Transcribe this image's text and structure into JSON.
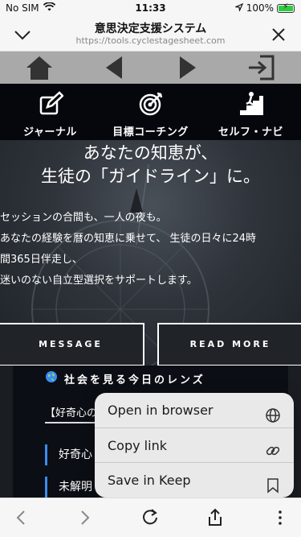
{
  "status_bar": {
    "carrier": "No SIM",
    "time": "11:33",
    "battery": "100%",
    "battery_level": 1.0
  },
  "browser": {
    "title": "意思決定支援システム",
    "url": "https://tools.cyclestagesheet.com"
  },
  "site_nav": {
    "icons": [
      "home-icon",
      "back-arrow-icon",
      "forward-arrow-icon",
      "logout-icon"
    ]
  },
  "category_menu": {
    "items": [
      {
        "label": "ジャーナル",
        "icon": "edit-icon"
      },
      {
        "label": "目標コーチング",
        "icon": "target-icon"
      },
      {
        "label": "セルフ・ナビ",
        "icon": "climb-stairs-icon"
      }
    ]
  },
  "hero": {
    "title_line1": "あなたの知恵が、",
    "title_line2": "生徒の「ガイドライン」に。",
    "body_line1": "セッションの合間も、一人の夜も。",
    "body_line2": "あなたの経験を暦の知恵に乗せて、 生徒の日々に24時",
    "body_line3": "間365日伴走し、",
    "body_line4": "迷いのない自立型選択をサポートします。",
    "btn_message": "MESSAGE",
    "btn_readmore": "READ MORE"
  },
  "lens": {
    "title": "社会を見る今日のレンズ",
    "tab": "【好奇心の",
    "item1": "好奇心",
    "item2": "未解明"
  },
  "context_menu": {
    "items": [
      {
        "label": "Open in browser",
        "icon": "globe-icon"
      },
      {
        "label": "Copy link",
        "icon": "link-icon"
      },
      {
        "label": "Save in Keep",
        "icon": "bookmark-icon"
      }
    ]
  },
  "toolbar": {
    "icons": [
      "back-icon",
      "forward-icon",
      "reload-icon",
      "share-icon",
      "more-icon"
    ]
  },
  "colors": {
    "accent": "#3a8df0",
    "battery": "#2ecc40",
    "nav_bar": "#a9a9a9",
    "menu_bg": "#05070c"
  }
}
